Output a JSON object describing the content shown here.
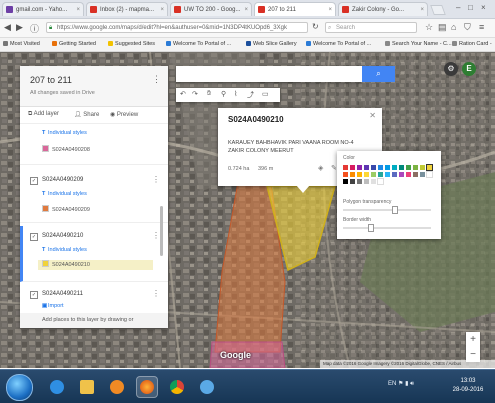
{
  "colors": {
    "accent": "#4285f4",
    "polygon_orange": "#e07a3e",
    "polygon_yellow": "#f0d23a",
    "polygon_pink": "#d9679a",
    "taskbar": "#1e3f62"
  },
  "tabs": [
    {
      "label": "gmail.com - Yaho...",
      "favicon_color": "#6d3fa6"
    },
    {
      "label": "Inbox (2) - mapma...",
      "favicon_color": "#d93025"
    },
    {
      "label": "UW TO 200 - Goog...",
      "favicon_color": "#d93025"
    },
    {
      "label": "207 to 211",
      "favicon_color": "#d93025"
    },
    {
      "label": "Zakir Colony - Go...",
      "favicon_color": "#d93025"
    }
  ],
  "address": {
    "url": "https://www.google.com/maps/d/edit?hl=en&authuser=0&mid=1N3DP4tKUOpd6_3Xgk",
    "search_placeholder": "Search",
    "reload_icon": "reload-icon"
  },
  "bookmarks": [
    {
      "label": "Most Visited",
      "color": "#777"
    },
    {
      "label": "Getting Started",
      "color": "#e8710a"
    },
    {
      "label": "Suggested Sites",
      "color": "#f2c200"
    },
    {
      "label": "Welcome To Portal of ...",
      "color": "#2b7bd6"
    },
    {
      "label": "Web Slice Gallery",
      "color": "#1b4f9c"
    },
    {
      "label": "Welcome To Portal of ...",
      "color": "#2b7bd6"
    },
    {
      "label": "Search Your Name - C...",
      "color": "#888"
    },
    {
      "label": "Ration Card -",
      "color": "#888"
    }
  ],
  "panel": {
    "title": "207 to 211",
    "subtitle": "All changes saved in Drive",
    "add_layer": "Add layer",
    "share": "Share",
    "preview": "Preview",
    "footer": "Add places to this layer by drawing or",
    "layers": [
      {
        "name": "",
        "style": "Individual styles",
        "feature": "S024A0490208",
        "swatch": "#d9679a",
        "partial": true
      },
      {
        "name": "S024A0490209",
        "style": "Individual styles",
        "feature": "S024A0490209",
        "swatch": "#e07a3e"
      },
      {
        "name": "S024A0490210",
        "style": "Individual styles",
        "feature": "S024A0490210",
        "swatch": "#f0d23a",
        "selected": true
      },
      {
        "name": "S024A0490211",
        "style": "Import",
        "feature": "",
        "swatch": ""
      }
    ]
  },
  "card": {
    "title": "S024A0490210",
    "line1": "KARAUEY BAHBHAVIK PARI VAANA ROOM NO-4",
    "line2": "ZAKIR COLONY MEERUT",
    "area": "0.724 ha",
    "perimeter": "396 m"
  },
  "color_popup": {
    "label": "Color",
    "transparency_label": "Polygon transparency",
    "transparency": 0.6,
    "border_label": "Border width",
    "border": 0.3,
    "selected_swatch": "#f0d23a"
  },
  "map": {
    "attribution": "Map data ©2016 Google Imagery ©2016 DigitalGlobe, CNES / Airbus",
    "logo": "Google"
  },
  "taskbar": {
    "tray_lang": "EN",
    "time": "13:03",
    "date": "28-09-2016"
  }
}
